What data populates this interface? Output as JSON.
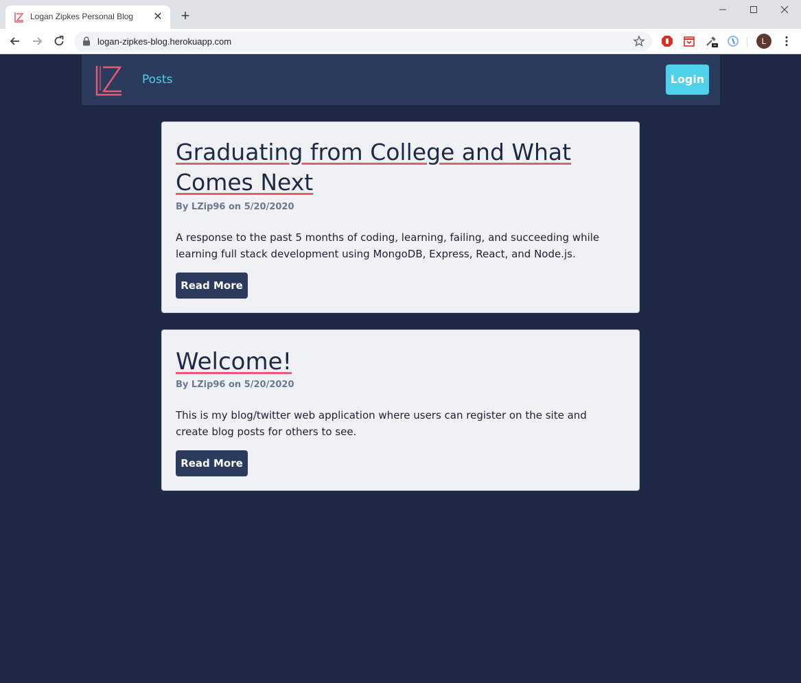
{
  "browser": {
    "tab_title": "Logan Zipkes Personal Blog",
    "url": "logan-zipkes-blog.herokuapp.com",
    "profile_initial": "L"
  },
  "site": {
    "nav_posts": "Posts",
    "login_label": "Login",
    "brand_color": "#e85a71",
    "accent_color": "#4fd1ea",
    "background_color": "#1e2a45"
  },
  "posts": [
    {
      "title": "Graduating from College and What Comes Next",
      "byline": "By LZip96 on 5/20/2020",
      "excerpt": "A response to the past 5 months of coding, learning, failing, and succeeding while learning full stack development using MongoDB, Express, React, and Node.js.",
      "button": "Read More"
    },
    {
      "title": "Welcome!",
      "byline": "By LZip96 on 5/20/2020",
      "excerpt": "This is my blog/twitter web application where users can register on the site and create blog posts for others to see.",
      "button": "Read More"
    }
  ]
}
